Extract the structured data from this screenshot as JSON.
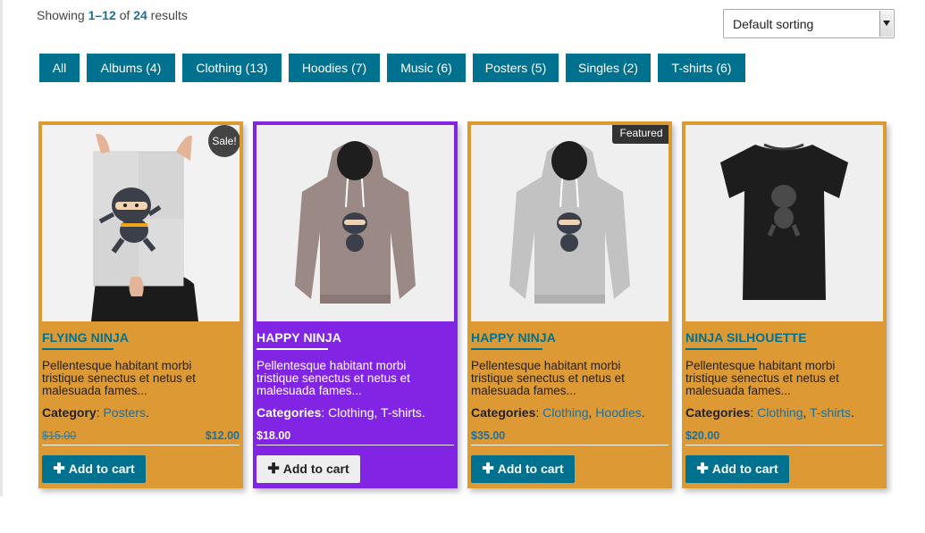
{
  "toolbar": {
    "result_prefix": "Showing ",
    "result_range": "1–12",
    "result_mid": " of ",
    "result_total": "24",
    "result_suffix": " results",
    "sort_selected": "Default sorting"
  },
  "filters": [
    {
      "label": "All"
    },
    {
      "label": "Albums (4)"
    },
    {
      "label": "Clothing (13)"
    },
    {
      "label": "Hoodies (7)"
    },
    {
      "label": "Music (6)"
    },
    {
      "label": "Posters (5)"
    },
    {
      "label": "Singles (2)"
    },
    {
      "label": "T-shirts (6)"
    }
  ],
  "colors": {
    "accent": "#00718f",
    "card_orange": "#dd9933",
    "card_purple": "#8224e3"
  },
  "products": [
    {
      "title": "FLYING NINJA",
      "description": "Pellentesque habitant morbi tristique senectus et netus et malesuada fames...",
      "category_label": "Category",
      "categories": [
        "Posters"
      ],
      "old_price": "$15.00",
      "price": "$12.00",
      "badge": "Sale!",
      "cart_label": "Add to cart",
      "image": "poster-ninja"
    },
    {
      "title": "HAPPY NINJA",
      "description": "Pellentesque habitant morbi tristique senectus et netus et malesuada fames...",
      "category_label": "Categories",
      "categories": [
        "Clothing",
        "T-shirts"
      ],
      "price": "$18.00",
      "cart_label": "Add to cart",
      "image": "hoodie-brown"
    },
    {
      "title": "HAPPY NINJA",
      "description": "Pellentesque habitant morbi tristique senectus et netus et malesuada fames...",
      "category_label": "Categories",
      "categories": [
        "Clothing",
        "Hoodies"
      ],
      "price": "$35.00",
      "badge": "Featured",
      "cart_label": "Add to cart",
      "image": "hoodie-grey"
    },
    {
      "title": "NINJA SILHOUETTE",
      "description": "Pellentesque habitant morbi tristique senectus et netus et malesuada fames...",
      "category_label": "Categories",
      "categories": [
        "Clothing",
        "T-shirts"
      ],
      "price": "$20.00",
      "cart_label": "Add to cart",
      "image": "tshirt-black"
    }
  ]
}
